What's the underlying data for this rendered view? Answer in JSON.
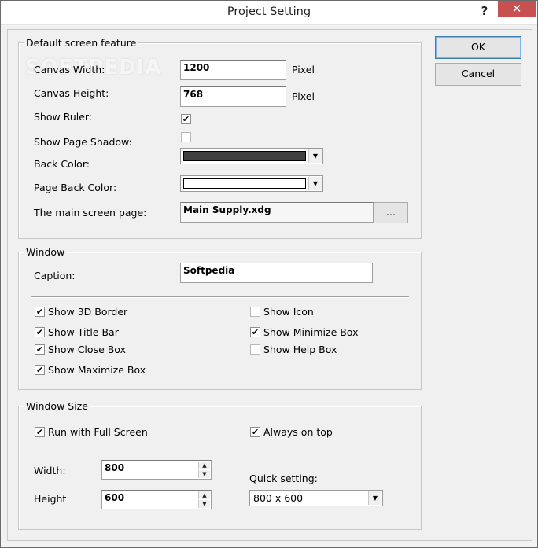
{
  "window": {
    "title": "Project Setting",
    "help_glyph": "?",
    "close_glyph": "✕"
  },
  "buttons": {
    "ok": "OK",
    "cancel": "Cancel",
    "browse": "..."
  },
  "default_screen": {
    "legend": "Default screen feature",
    "canvas_width_label": "Canvas Width:",
    "canvas_width_value": "1200",
    "canvas_height_label": "Canvas Height:",
    "canvas_height_value": "768",
    "pixel_unit": "Pixel",
    "show_ruler_label": "Show Ruler:",
    "show_ruler_checked": true,
    "show_page_shadow_label": "Show Page Shadow:",
    "show_page_shadow_checked": false,
    "back_color_label": "Back Color:",
    "back_color": "#404040",
    "page_back_color_label": "Page Back Color:",
    "page_back_color": "#ffffff",
    "main_page_label": "The main screen page:",
    "main_page_value": "Main Supply.xdg"
  },
  "window_group": {
    "legend": "Window",
    "caption_label": "Caption:",
    "caption_value": "Softpedia",
    "options": [
      {
        "label": "Show 3D Border",
        "checked": true
      },
      {
        "label": "Show Title Bar",
        "checked": true
      },
      {
        "label": "Show Close Box",
        "checked": true
      },
      {
        "label": "Show Maximize Box",
        "checked": true
      },
      {
        "label": "Show Icon",
        "checked": false
      },
      {
        "label": "Show Minimize Box",
        "checked": true
      },
      {
        "label": "Show Help Box",
        "checked": false
      }
    ]
  },
  "window_size": {
    "legend": "Window Size",
    "full_screen_label": "Run with Full Screen",
    "full_screen_checked": true,
    "always_on_top_label": "Always on top",
    "always_on_top_checked": true,
    "width_label": "Width:",
    "width_value": "800",
    "height_label": "Height",
    "height_value": "600",
    "quick_setting_label": "Quick setting:",
    "quick_setting_value": "800 x 600"
  },
  "watermark": "SOFTPEDIA",
  "icons": {
    "check": "✔",
    "dropdown": "▼",
    "spin_up": "▲",
    "spin_down": "▼"
  }
}
